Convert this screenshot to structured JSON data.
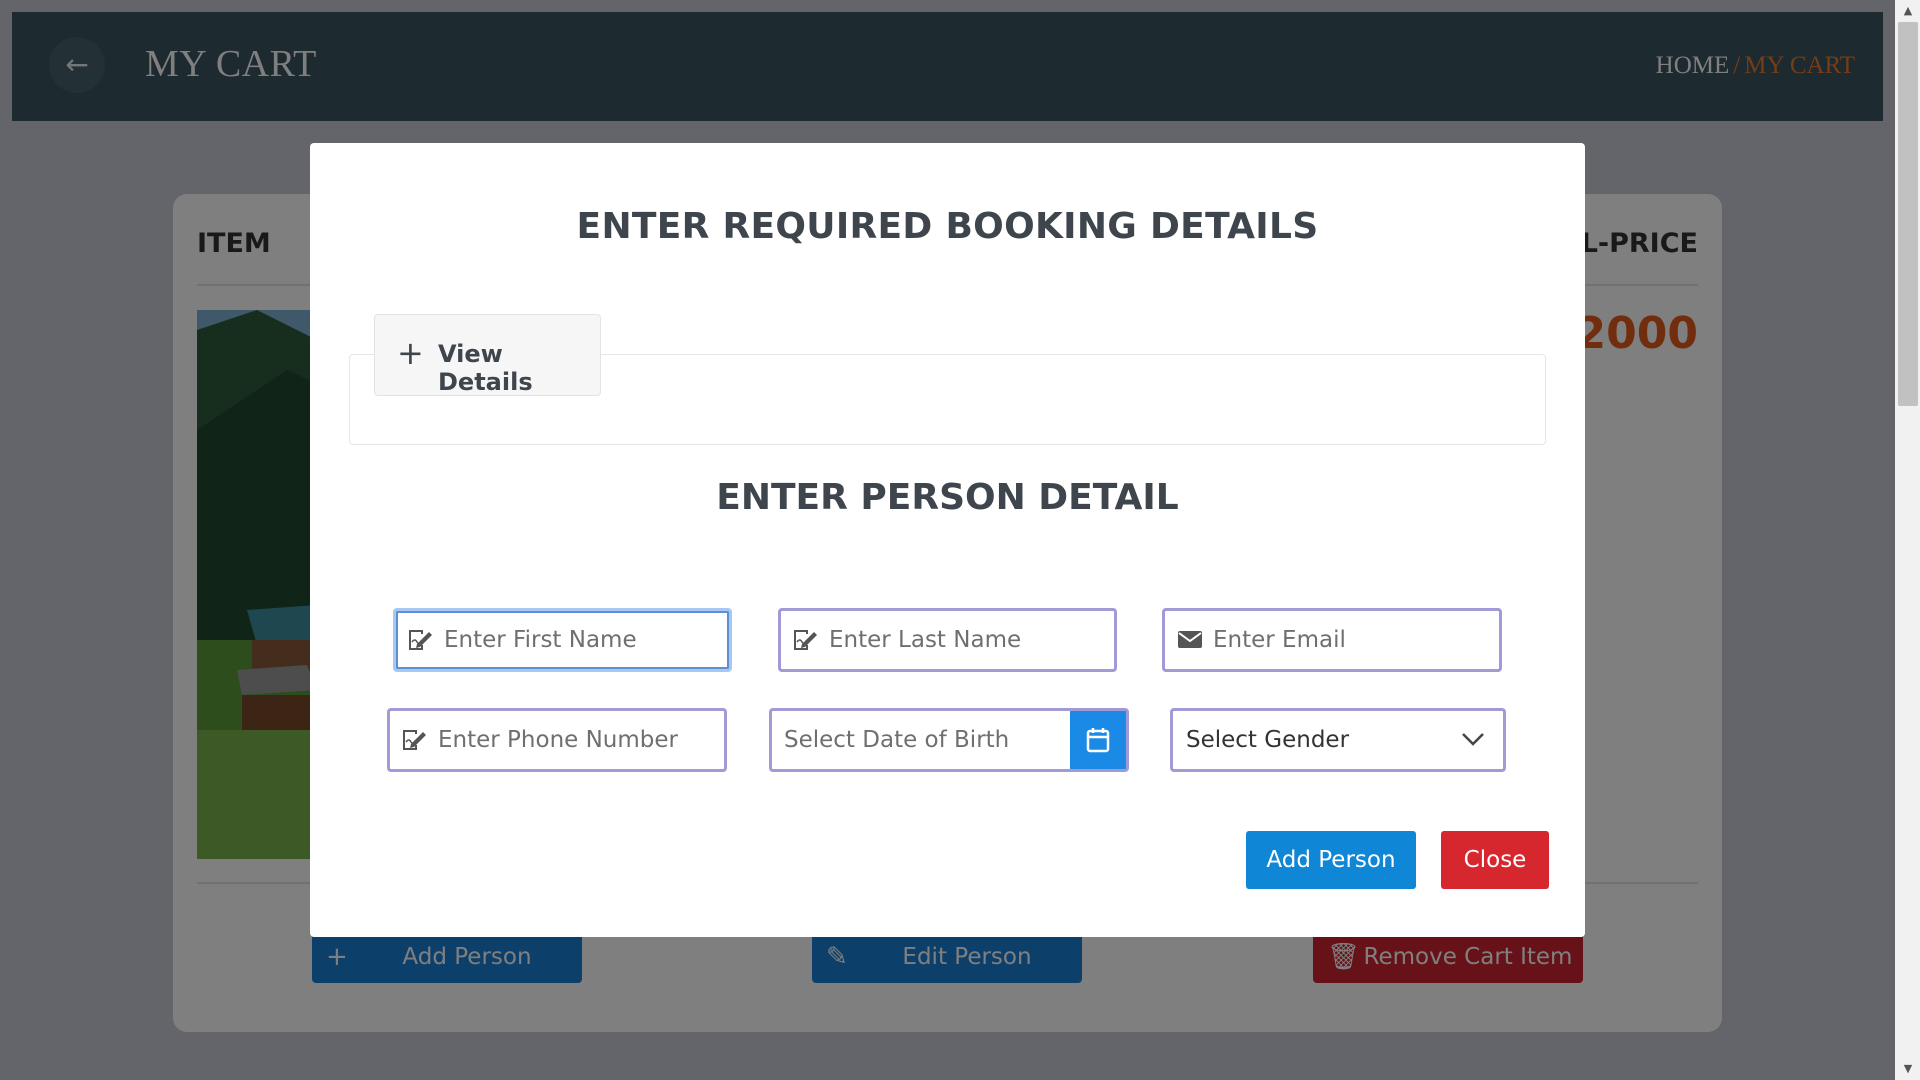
{
  "header": {
    "title": "MY CART",
    "breadcrumb": {
      "home": "HOME",
      "separator": "/",
      "current": "MY CART"
    }
  },
  "cart": {
    "columns": {
      "item": "ITEM",
      "total_price": "AL-PRICE"
    },
    "price": "2000",
    "buttons": {
      "add_person": "Add Person",
      "edit_person": "Edit Person",
      "remove_cart_item": "Remove Cart Item"
    }
  },
  "modal": {
    "title": "ENTER REQUIRED BOOKING DETAILS",
    "view_details_label": "View Details",
    "section_title": "ENTER PERSON DETAIL",
    "fields": {
      "first_name": {
        "placeholder": "Enter First Name",
        "value": ""
      },
      "last_name": {
        "placeholder": "Enter Last Name",
        "value": ""
      },
      "email": {
        "placeholder": "Enter Email",
        "value": ""
      },
      "phone": {
        "placeholder": "Enter Phone Number",
        "value": ""
      },
      "dob": {
        "placeholder": "Select Date of Birth",
        "value": ""
      },
      "gender": {
        "selected": "Select Gender"
      }
    },
    "buttons": {
      "add_person": "Add Person",
      "close": "Close"
    }
  },
  "colors": {
    "header_bg": "#3b5460",
    "accent_orange": "#e87a2d",
    "primary_blue": "#0f86d6",
    "danger_red": "#d6262e",
    "field_border": "#a09ad6"
  },
  "icons": {
    "back": "arrow-left-icon",
    "plus": "plus-icon",
    "edit": "edit-icon",
    "trash": "trash-icon",
    "signature": "signature-icon",
    "envelope": "envelope-icon",
    "calendar": "calendar-icon",
    "chevron": "chevron-down-icon"
  }
}
